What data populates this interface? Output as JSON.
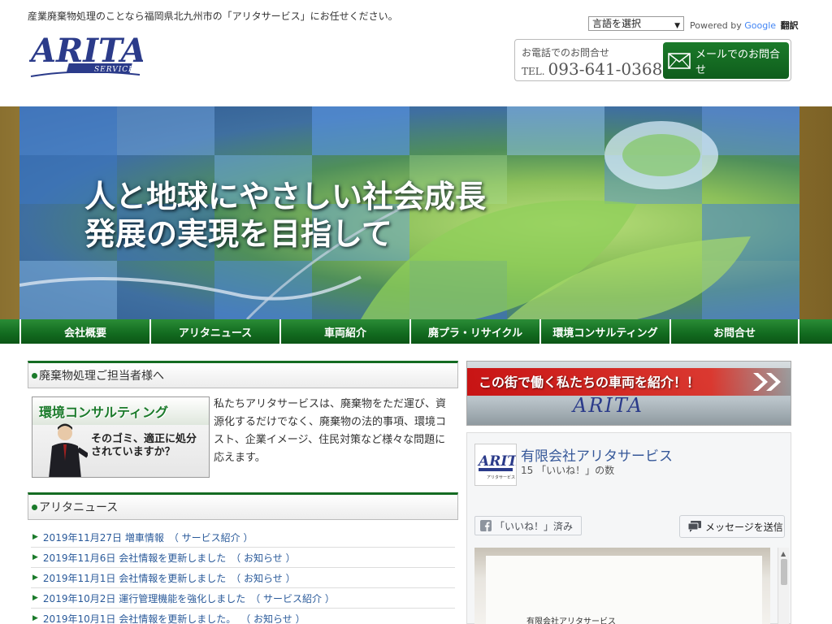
{
  "header": {
    "tagline": "産業廃棄物処理のことなら福岡県北九州市の「アリタサービス」にお任せください。",
    "logo_main": "ARITA",
    "logo_sub": "SERVICE",
    "language_select": "言語を選択",
    "powered_by": "Powered by",
    "google": "Google",
    "translate": "翻訳",
    "tel_label": "お電話でのお問合せ",
    "tel_prefix": "TEL.",
    "tel_number": "093-641-0368",
    "mail_button": "メールでのお問合せ"
  },
  "hero": {
    "line1": "人と地球にやさしい社会成長",
    "line2": "発展の実現を目指して"
  },
  "nav": {
    "items": [
      "会社概要",
      "アリタニュース",
      "車両紹介",
      "廃プラ・リサイクル",
      "環境コンサルティング",
      "お問合せ"
    ]
  },
  "left": {
    "section1_title": "廃棄物処理ご担当者様へ",
    "consult_title": "環境コンサルティング",
    "consult_q1": "そのゴミ、適正に処分",
    "consult_q2": "されていますか？",
    "intro": "私たちアリタサービスは、廃棄物をただ運び、資源化するだけでなく、廃棄物の法的事項、環境コスト、企業イメージ、住民対策など様々な問題に応えます。",
    "section2_title": "アリタニュース",
    "news": [
      {
        "date": "2019年11月27日",
        "title": "増車情報",
        "cat": "（ サービス紹介 ）"
      },
      {
        "date": "2019年11月6日",
        "title": "会社情報を更新しました",
        "cat": "（ お知らせ ）"
      },
      {
        "date": "2019年11月1日",
        "title": "会社情報を更新しました",
        "cat": "（ お知らせ ）"
      },
      {
        "date": "2019年10月2日",
        "title": "運行管理機能を強化しました",
        "cat": "（ サービス紹介 ）"
      },
      {
        "date": "2019年10月1日",
        "title": "会社情報を更新しました。",
        "cat": "（ お知らせ ）"
      }
    ]
  },
  "right": {
    "vehicle_banner": "この街で働く私たちの車両を紹介！！",
    "vehicle_brand": "ARITA",
    "fb_name": "有限会社アリタサービス",
    "fb_likes": "15 「いいね！」の数",
    "fb_liked": "「いいね！」済み",
    "fb_message": "メッセージを送信",
    "fb_thumb_sub": "アリタサービス",
    "fb_post_text": "有限会社アリタサービス"
  },
  "colors": {
    "brand_green": "#146b22",
    "logo_blue": "#2b3b8a",
    "link_blue": "#2a5a9a",
    "banner_red": "#d0141a"
  }
}
